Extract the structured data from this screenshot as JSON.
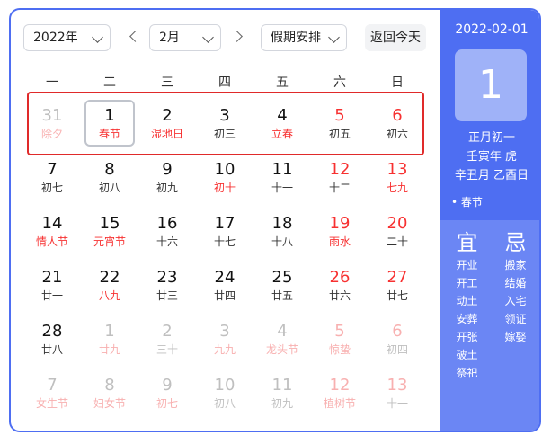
{
  "toolbar": {
    "year_select": "2022年",
    "month_select": "2月",
    "holiday_select": "假期安排",
    "today_button": "返回今天"
  },
  "weekdays": [
    "一",
    "二",
    "三",
    "四",
    "五",
    "六",
    "日"
  ],
  "weeks": [
    [
      {
        "day": "31",
        "sub": "除夕",
        "dim": true,
        "red": true
      },
      {
        "day": "1",
        "sub": "春节",
        "red": true,
        "selected": true
      },
      {
        "day": "2",
        "sub": "湿地日",
        "red": true
      },
      {
        "day": "3",
        "sub": "初三"
      },
      {
        "day": "4",
        "sub": "立春",
        "red": true
      },
      {
        "day": "5",
        "sub": "初五",
        "weekend": true
      },
      {
        "day": "6",
        "sub": "初六",
        "weekend": true
      }
    ],
    [
      {
        "day": "7",
        "sub": "初七"
      },
      {
        "day": "8",
        "sub": "初八"
      },
      {
        "day": "9",
        "sub": "初九"
      },
      {
        "day": "10",
        "sub": "初十",
        "red": true
      },
      {
        "day": "11",
        "sub": "十一"
      },
      {
        "day": "12",
        "sub": "十二",
        "weekend": true
      },
      {
        "day": "13",
        "sub": "七九",
        "weekend": true,
        "red": true
      }
    ],
    [
      {
        "day": "14",
        "sub": "情人节",
        "red": true
      },
      {
        "day": "15",
        "sub": "元宵节",
        "red": true
      },
      {
        "day": "16",
        "sub": "十六"
      },
      {
        "day": "17",
        "sub": "十七"
      },
      {
        "day": "18",
        "sub": "十八"
      },
      {
        "day": "19",
        "sub": "雨水",
        "weekend": true,
        "red": true
      },
      {
        "day": "20",
        "sub": "二十",
        "weekend": true
      }
    ],
    [
      {
        "day": "21",
        "sub": "廿一"
      },
      {
        "day": "22",
        "sub": "八九",
        "red": true
      },
      {
        "day": "23",
        "sub": "廿三"
      },
      {
        "day": "24",
        "sub": "廿四"
      },
      {
        "day": "25",
        "sub": "廿五"
      },
      {
        "day": "26",
        "sub": "廿六",
        "weekend": true
      },
      {
        "day": "27",
        "sub": "廿七",
        "weekend": true
      }
    ],
    [
      {
        "day": "28",
        "sub": "廿八"
      },
      {
        "day": "1",
        "sub": "廿九",
        "dim": true,
        "red": true
      },
      {
        "day": "2",
        "sub": "三十",
        "dim": true
      },
      {
        "day": "3",
        "sub": "九九",
        "dim": true,
        "red": true
      },
      {
        "day": "4",
        "sub": "龙头节",
        "dim": true,
        "red": true
      },
      {
        "day": "5",
        "sub": "惊蛰",
        "dim": true,
        "weekend": true,
        "red": true
      },
      {
        "day": "6",
        "sub": "初四",
        "dim": true,
        "weekend": true
      }
    ],
    [
      {
        "day": "7",
        "sub": "女生节",
        "dim": true,
        "red": true
      },
      {
        "day": "8",
        "sub": "妇女节",
        "dim": true,
        "red": true
      },
      {
        "day": "9",
        "sub": "初七",
        "dim": true,
        "red": true
      },
      {
        "day": "10",
        "sub": "初八",
        "dim": true
      },
      {
        "day": "11",
        "sub": "初九",
        "dim": true
      },
      {
        "day": "12",
        "sub": "植树节",
        "dim": true,
        "weekend": true,
        "red": true
      },
      {
        "day": "13",
        "sub": "十一",
        "dim": true,
        "weekend": true
      }
    ]
  ],
  "side": {
    "date": "2022-02-01",
    "big_day": "1",
    "lunar_date": "正月初一",
    "year_gz": "壬寅年 虎",
    "month_day_gz": "辛丑月 乙酉日",
    "festival": "• 春节",
    "yi_title": "宜",
    "ji_title": "忌",
    "yi": [
      "开业",
      "开工",
      "动土",
      "安葬",
      "开张",
      "破土",
      "祭祀"
    ],
    "ji": [
      "搬家",
      "结婚",
      "入宅",
      "领证",
      "嫁娶"
    ]
  },
  "colors": {
    "accent": "#4e6ef2",
    "holiday_red": "#f73131",
    "highlight_border": "#e02a2a"
  }
}
